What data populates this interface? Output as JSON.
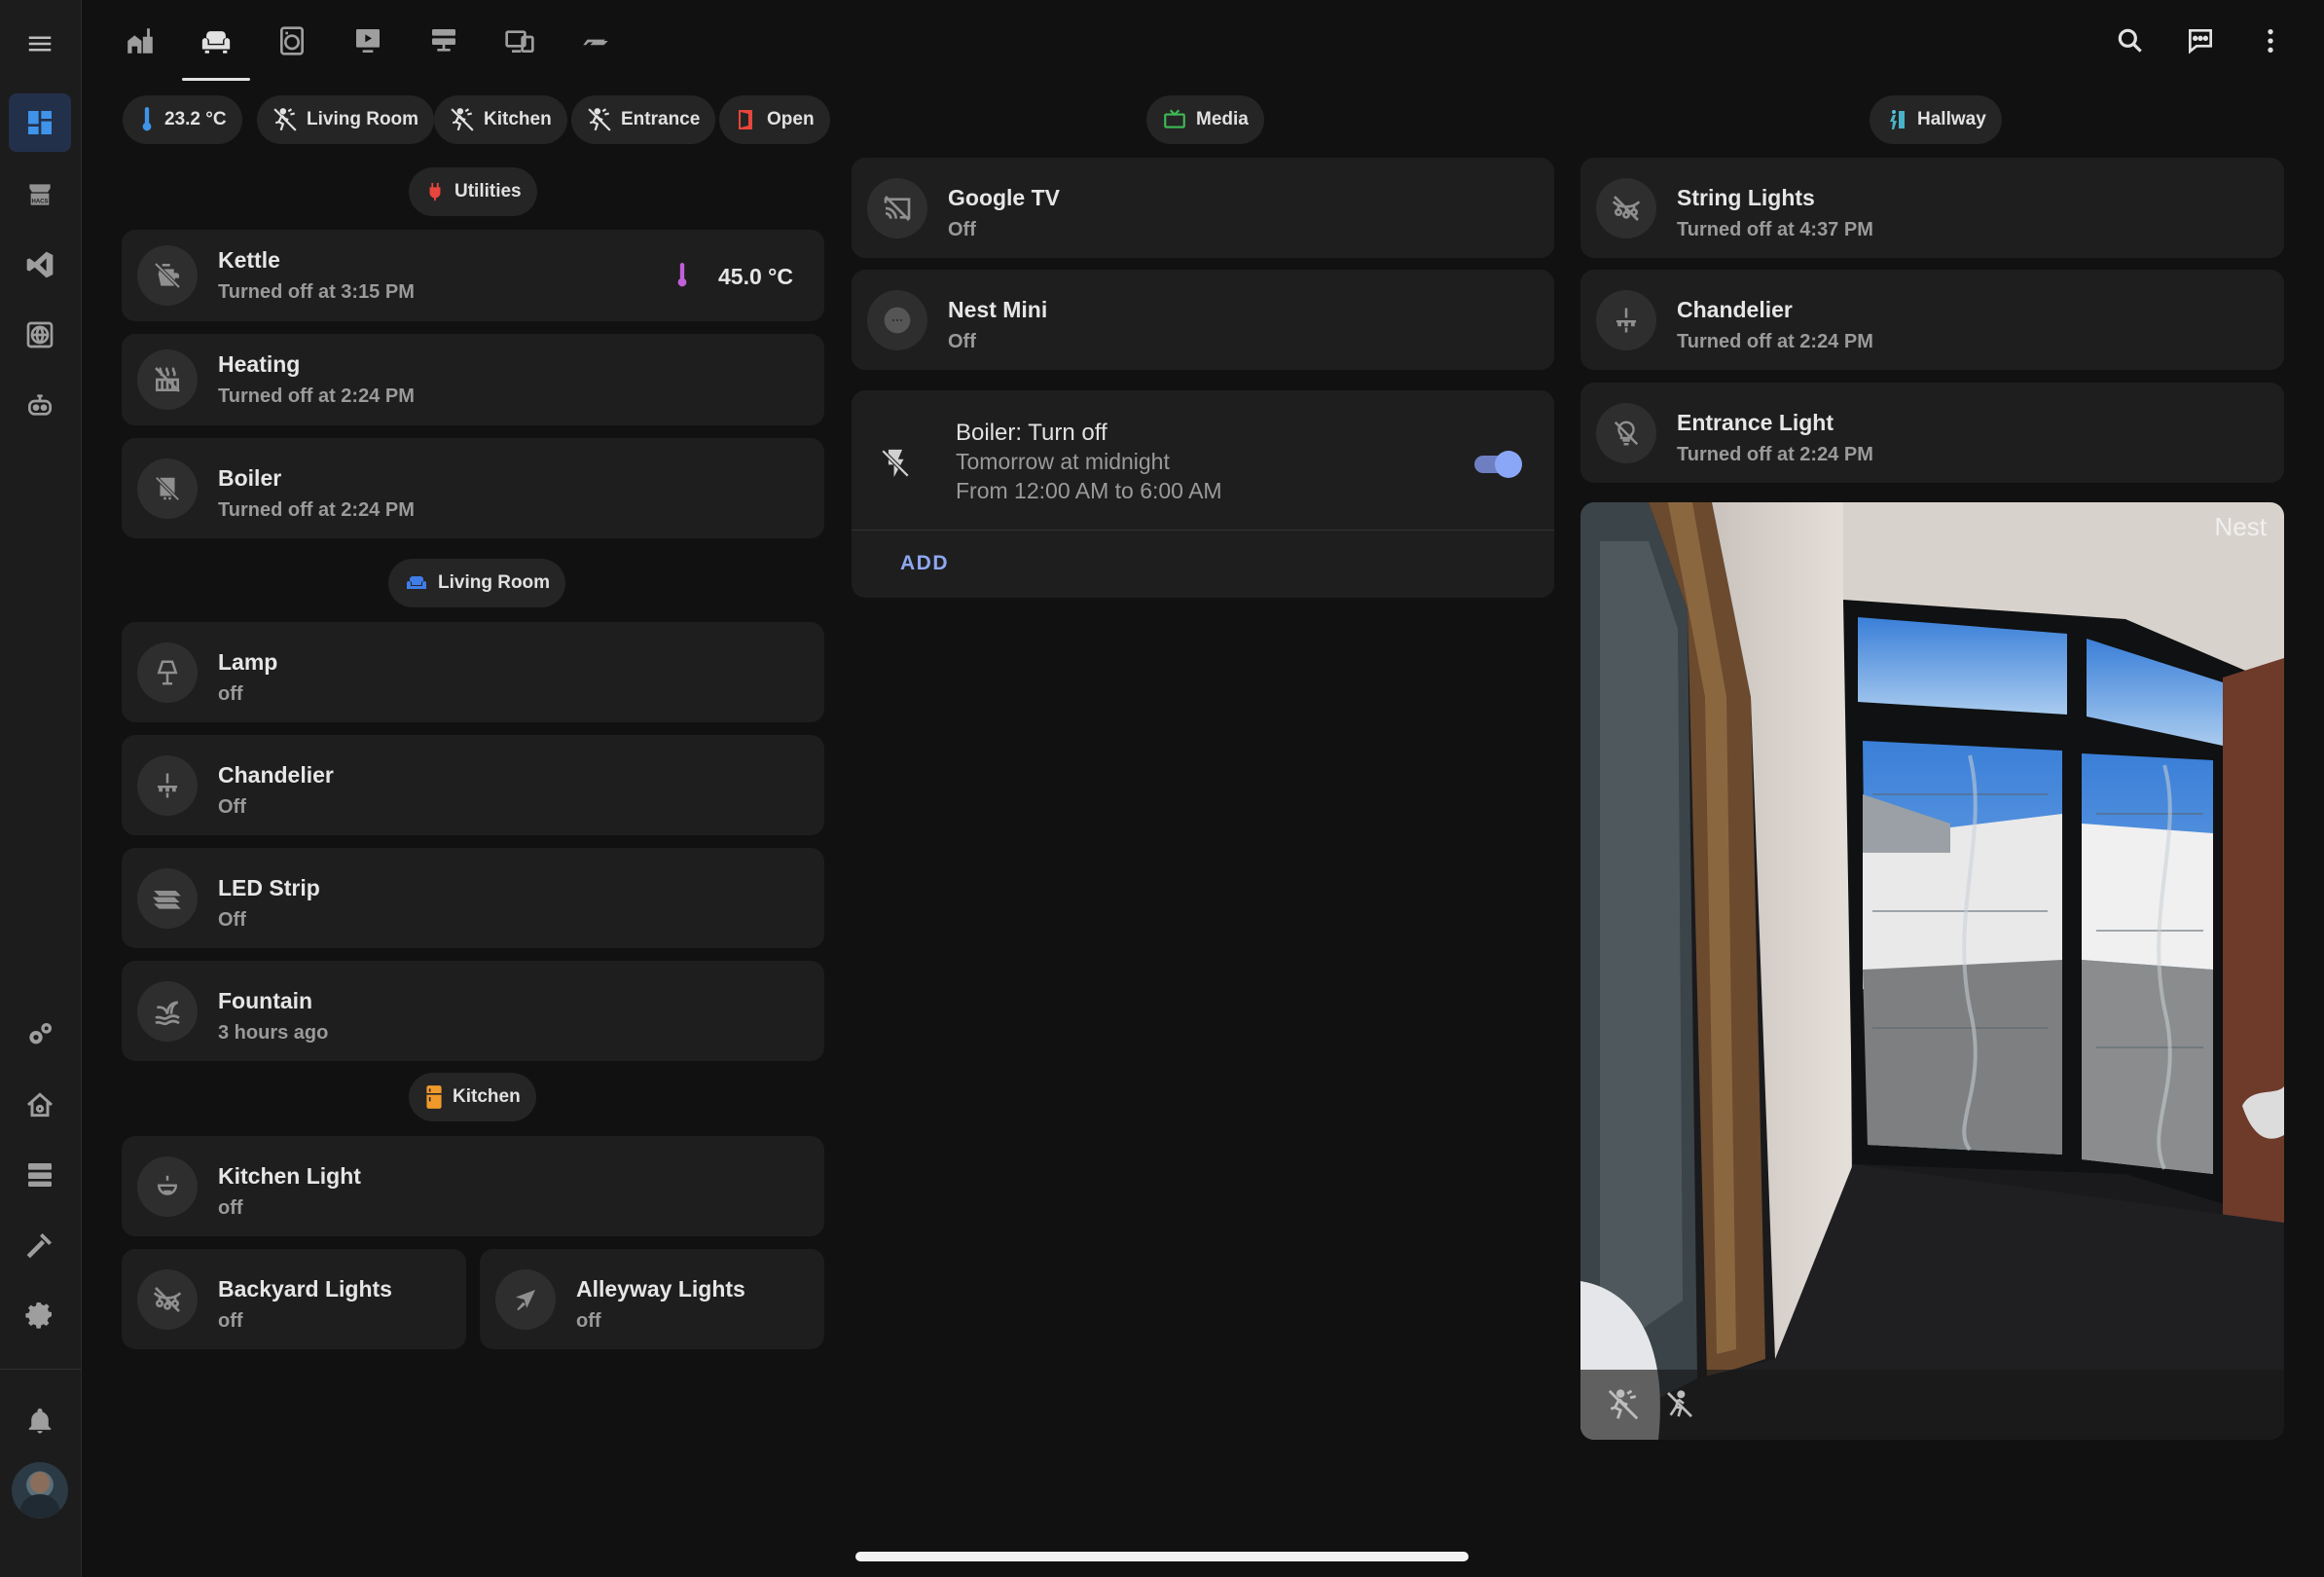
{
  "tabs": [
    {
      "icon": "home-automation-icon"
    },
    {
      "icon": "sofa-icon"
    },
    {
      "icon": "washing-machine-icon"
    },
    {
      "icon": "monitor-play-icon"
    },
    {
      "icon": "server-icon"
    },
    {
      "icon": "devices-icon"
    },
    {
      "icon": "formula1-icon"
    }
  ],
  "topbar": {
    "search_icon": "magnify-icon",
    "assist_icon": "chat-icon",
    "menu_icon": "dots-vertical-icon"
  },
  "chips": {
    "temperature": "23.2 °C",
    "living_room": "Living Room",
    "kitchen": "Kitchen",
    "entrance": "Entrance",
    "door": "Open",
    "media": "Media",
    "hallway": "Hallway",
    "utilities": "Utilities",
    "living_room_section": "Living Room",
    "kitchen_section": "Kitchen"
  },
  "colors": {
    "accent": "#3f93e8",
    "chip_bg": "#252525",
    "tile_bg": "#1e1e1e",
    "temp_icon": "#3f93e8",
    "door_icon": "#e8453c",
    "media_icon": "#3dbb54",
    "hallway_icon": "#4dc3d9",
    "utilities_icon": "#e8453c",
    "living_room_icon": "#3f7de8",
    "kitchen_icon": "#f09a2b",
    "kettle_temp_icon": "#c060d8",
    "toggle": "#8aa7f7"
  },
  "utilities": [
    {
      "name": "Kettle",
      "state": "Turned off at 3:15 PM",
      "value": "45.0 °C",
      "icon": "kettle-off-icon"
    },
    {
      "name": "Heating",
      "state": "Turned off at 2:24 PM",
      "icon": "radiator-off-icon"
    },
    {
      "name": "Boiler",
      "state": "Turned off at 2:24 PM",
      "icon": "water-boiler-off-icon"
    }
  ],
  "living_room": [
    {
      "name": "Lamp",
      "state": "off",
      "icon": "lamp-icon"
    },
    {
      "name": "Chandelier",
      "state": "Off",
      "icon": "chandelier-icon"
    },
    {
      "name": "LED Strip",
      "state": "Off",
      "icon": "led-strip-icon"
    },
    {
      "name": "Fountain",
      "state": "3 hours ago",
      "icon": "fountain-icon"
    }
  ],
  "kitchen": [
    {
      "name": "Kitchen Light",
      "state": "off",
      "icon": "ceiling-light-icon"
    },
    {
      "name": "Backyard Lights",
      "state": "off",
      "icon": "string-lights-off-icon"
    },
    {
      "name": "Alleyway Lights",
      "state": "off",
      "icon": "outdoor-lamp-icon"
    }
  ],
  "media": [
    {
      "name": "Google TV",
      "state": "Off",
      "icon": "cast-off-icon"
    },
    {
      "name": "Nest Mini",
      "state": "Off",
      "icon": "speaker-icon"
    }
  ],
  "schedule": {
    "title": "Boiler: Turn off",
    "when": "Tomorrow at midnight",
    "range": "From 12:00 AM to 6:00 AM",
    "enabled": true,
    "add_label": "ADD",
    "icon": "flash-off-icon"
  },
  "hallway": [
    {
      "name": "String Lights",
      "state": "Turned off at 4:37 PM",
      "icon": "string-lights-off-icon"
    },
    {
      "name": "Chandelier",
      "state": "Turned off at 2:24 PM",
      "icon": "chandelier-icon"
    },
    {
      "name": "Entrance Light",
      "state": "Turned off at 2:24 PM",
      "icon": "lightbulb-off-icon"
    }
  ],
  "camera": {
    "label": "Nest",
    "buttons": [
      "motion-sensor-off-icon",
      "walk-off-icon"
    ]
  }
}
